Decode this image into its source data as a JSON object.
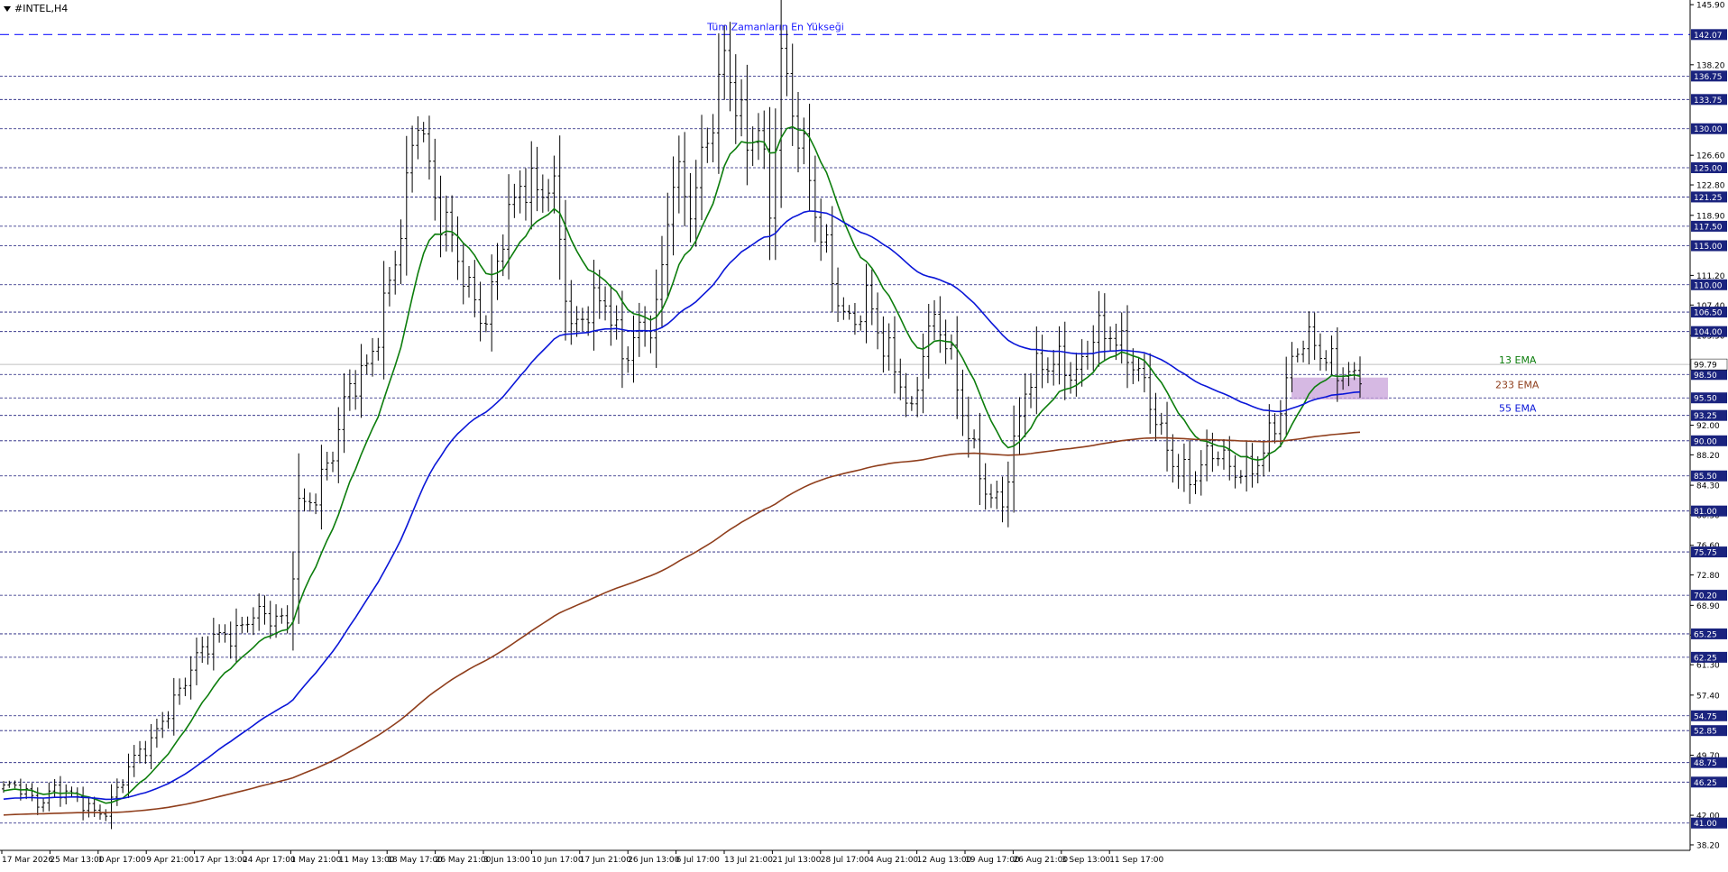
{
  "symbol": "#INTEL,H4",
  "annotation_ath": "Tüm Zamanların En Yükseği",
  "chart_data": {
    "type": "candlestick",
    "title": "#INTEL,H4",
    "ylim": [
      37.5,
      146.5
    ],
    "y_scale_ticks": [
      "145.90",
      "138.20",
      "126.60",
      "122.80",
      "118.90",
      "111.20",
      "107.40",
      "103.50",
      "92.00",
      "88.20",
      "84.30",
      "80.50",
      "76.60",
      "72.80",
      "68.90",
      "65.10",
      "61.30",
      "57.40",
      "49.70",
      "42.00",
      "38.20"
    ],
    "levels": [
      {
        "label": "142.07",
        "value": 142.07,
        "style": "long-dash",
        "color": "#1a1aff"
      },
      {
        "label": "136.75",
        "value": 136.75
      },
      {
        "label": "133.75",
        "value": 133.75
      },
      {
        "label": "130.00",
        "value": 130.0
      },
      {
        "label": "125.00",
        "value": 125.0
      },
      {
        "label": "121.25",
        "value": 121.25
      },
      {
        "label": "117.50",
        "value": 117.5
      },
      {
        "label": "115.00",
        "value": 115.0
      },
      {
        "label": "110.00",
        "value": 110.0
      },
      {
        "label": "106.50",
        "value": 106.5
      },
      {
        "label": "104.00",
        "value": 104.0
      },
      {
        "label": "98.50",
        "value": 98.5
      },
      {
        "label": "95.50",
        "value": 95.5
      },
      {
        "label": "93.25",
        "value": 93.25
      },
      {
        "label": "90.00",
        "value": 90.0
      },
      {
        "label": "85.50",
        "value": 85.5
      },
      {
        "label": "81.00",
        "value": 81.0
      },
      {
        "label": "75.75",
        "value": 75.75
      },
      {
        "label": "70.20",
        "value": 70.2
      },
      {
        "label": "65.25",
        "value": 65.25
      },
      {
        "label": "62.25",
        "value": 62.25
      },
      {
        "label": "54.75",
        "value": 54.75
      },
      {
        "label": "52.85",
        "value": 52.85
      },
      {
        "label": "48.75",
        "value": 48.75
      },
      {
        "label": "46.25",
        "value": 46.25
      },
      {
        "label": "41.00",
        "value": 41.0
      }
    ],
    "current_price": {
      "label": "99.79",
      "value": 99.79
    },
    "x_labels": [
      "17 Mar 2026",
      "25 Mar 13:00",
      "1 Apr 17:00",
      "9 Apr 21:00",
      "17 Apr 13:00",
      "24 Apr 17:00",
      "1 May 21:00",
      "11 May 13:00",
      "18 May 17:00",
      "26 May 21:00",
      "3 Jun 13:00",
      "10 Jun 17:00",
      "17 Jun 21:00",
      "26 Jun 13:00",
      "6 Jul 17:00",
      "13 Jul 21:00",
      "21 Jul 13:00",
      "28 Jul 17:00",
      "4 Aug 21:00",
      "12 Aug 13:00",
      "19 Aug 17:00",
      "26 Aug 21:00",
      "3 Sep 13:00",
      "11 Sep 17:00"
    ],
    "price_path_keypoints": [
      [
        0,
        45.0
      ],
      [
        3,
        45.5
      ],
      [
        6,
        44.0
      ],
      [
        9,
        45.5
      ],
      [
        12,
        44.0
      ],
      [
        16,
        42.5
      ],
      [
        18,
        43.0
      ],
      [
        22,
        48.0
      ],
      [
        26,
        51.0
      ],
      [
        29,
        56.0
      ],
      [
        33,
        61.0
      ],
      [
        37,
        64.0
      ],
      [
        41,
        66.0
      ],
      [
        44,
        68.5
      ],
      [
        46,
        67.0
      ],
      [
        50,
        66.0
      ],
      [
        52,
        82.0
      ],
      [
        55,
        84.0
      ],
      [
        58,
        88.0
      ],
      [
        61,
        96.0
      ],
      [
        64,
        100.0
      ],
      [
        67,
        108.0
      ],
      [
        70,
        116.0
      ],
      [
        73,
        131.0
      ],
      [
        76,
        122.0
      ],
      [
        79,
        117.0
      ],
      [
        82,
        108.0
      ],
      [
        85,
        104.0
      ],
      [
        88,
        118.0
      ],
      [
        91,
        124.0
      ],
      [
        94,
        121.0
      ],
      [
        97,
        121.0
      ],
      [
        100,
        105.0
      ],
      [
        103,
        108.0
      ],
      [
        106,
        107.0
      ],
      [
        109,
        100.0
      ],
      [
        112,
        105.0
      ],
      [
        115,
        107.0
      ],
      [
        118,
        123.0
      ],
      [
        121,
        119.0
      ],
      [
        124,
        130.0
      ],
      [
        127,
        140.0
      ],
      [
        129,
        133.0
      ],
      [
        131,
        126.0
      ],
      [
        133,
        130.0
      ],
      [
        135,
        120.0
      ],
      [
        137,
        141.0
      ],
      [
        139,
        133.0
      ],
      [
        141,
        126.0
      ],
      [
        143,
        118.0
      ],
      [
        146,
        111.0
      ],
      [
        149,
        106.0
      ],
      [
        152,
        108.0
      ],
      [
        155,
        101.0
      ],
      [
        158,
        98.0
      ],
      [
        160,
        94.0
      ],
      [
        162,
        103.0
      ],
      [
        164,
        105.0
      ],
      [
        166,
        102.0
      ],
      [
        168,
        96.0
      ],
      [
        171,
        89.0
      ],
      [
        174,
        83.0
      ],
      [
        176,
        82.0
      ],
      [
        178,
        88.0
      ],
      [
        180,
        96.0
      ],
      [
        183,
        101.0
      ],
      [
        186,
        101.0
      ],
      [
        189,
        97.0
      ],
      [
        192,
        103.0
      ],
      [
        195,
        105.0
      ],
      [
        198,
        102.0
      ],
      [
        201,
        96.0
      ],
      [
        204,
        90.0
      ],
      [
        207,
        87.0
      ],
      [
        210,
        86.0
      ],
      [
        213,
        88.0
      ],
      [
        216,
        86.0
      ],
      [
        219,
        87.0
      ],
      [
        222,
        89.0
      ],
      [
        225,
        93.0
      ],
      [
        228,
        102.0
      ],
      [
        231,
        104.0
      ],
      [
        234,
        100.0
      ],
      [
        236,
        98.0
      ],
      [
        238,
        96.5
      ],
      [
        240,
        99.5
      ]
    ],
    "series": [
      {
        "name": "13 EMA",
        "color": "#0c7d0c",
        "period": 13
      },
      {
        "name": "55 EMA",
        "color": "#0a16d8",
        "period": 55
      },
      {
        "name": "233 EMA",
        "color": "#8f3e1c",
        "period": 233
      }
    ],
    "zone": {
      "from": 95.3,
      "to": 98.1,
      "color": "#c8a2d9"
    }
  },
  "labels": {
    "ema13": "13 EMA",
    "ema233": "233 EMA",
    "ema55": "55 EMA"
  }
}
